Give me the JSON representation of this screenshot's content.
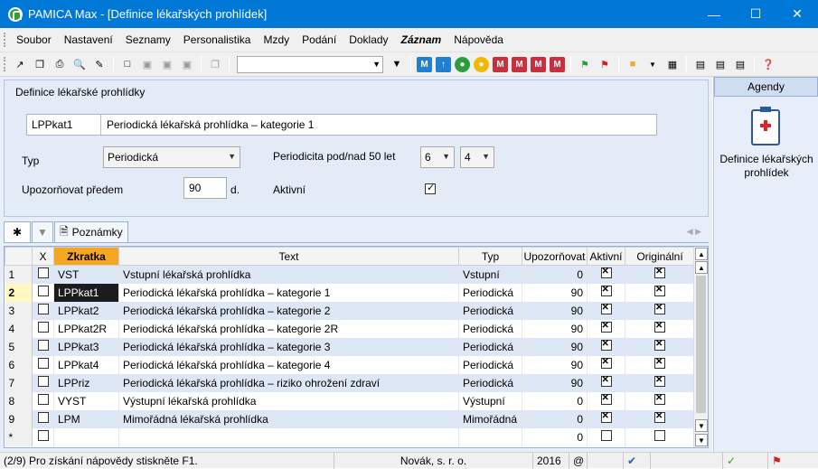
{
  "window": {
    "title": "PAMICA Max - [Definice lékařských prohlídek]"
  },
  "menu": [
    "Soubor",
    "Nastavení",
    "Seznamy",
    "Personalistika",
    "Mzdy",
    "Podání",
    "Doklady",
    "Záznam",
    "Nápověda"
  ],
  "form": {
    "title": "Definice lékařské prohlídky",
    "code": "LPPkat1",
    "name": "Periodická lékařská prohlídka – kategorie 1",
    "type_label": "Typ",
    "type_value": "Periodická",
    "periodicity_label": "Periodicita pod/nad 50 let",
    "periodicity_under": "6",
    "periodicity_over": "4",
    "notify_label": "Upozorňovat předem",
    "notify_value": "90",
    "notify_unit": "d.",
    "active_label": "Aktivní"
  },
  "tabs": {
    "notes": "Poznámky"
  },
  "grid": {
    "columns": [
      "X",
      "Zkratka",
      "Text",
      "Typ",
      "Upozorňovat",
      "Aktivní",
      "Originální"
    ],
    "rows": [
      {
        "n": "1",
        "code": "VST",
        "text": "Vstupní lékařská prohlídka",
        "type": "Vstupní",
        "notify": "0"
      },
      {
        "n": "2",
        "code": "LPPkat1",
        "text": "Periodická lékařská prohlídka – kategorie 1",
        "type": "Periodická",
        "notify": "90"
      },
      {
        "n": "3",
        "code": "LPPkat2",
        "text": "Periodická lékařská prohlídka – kategorie 2",
        "type": "Periodická",
        "notify": "90"
      },
      {
        "n": "4",
        "code": "LPPkat2R",
        "text": "Periodická lékařská prohlídka – kategorie 2R",
        "type": "Periodická",
        "notify": "90"
      },
      {
        "n": "5",
        "code": "LPPkat3",
        "text": "Periodická lékařská prohlídka – kategorie 3",
        "type": "Periodická",
        "notify": "90"
      },
      {
        "n": "6",
        "code": "LPPkat4",
        "text": "Periodická lékařská prohlídka – kategorie 4",
        "type": "Periodická",
        "notify": "90"
      },
      {
        "n": "7",
        "code": "LPPriz",
        "text": "Periodická lékařská prohlídka – riziko ohrožení zdraví",
        "type": "Periodická",
        "notify": "90"
      },
      {
        "n": "8",
        "code": "VYST",
        "text": "Výstupní lékařská prohlídka",
        "type": "Výstupní",
        "notify": "0"
      },
      {
        "n": "9",
        "code": "LPM",
        "text": "Mimořádná lékařská prohlídka",
        "type": "Mimořádná",
        "notify": "0"
      },
      {
        "n": "*",
        "code": "",
        "text": "",
        "type": "",
        "notify": "0"
      }
    ]
  },
  "agendy": {
    "header": "Agendy",
    "item": "Definice lékařských prohlídek"
  },
  "status": {
    "hint": "(2/9) Pro získání nápovědy stiskněte F1.",
    "company": "Novák, s. r. o.",
    "year": "2016",
    "at": "@"
  }
}
